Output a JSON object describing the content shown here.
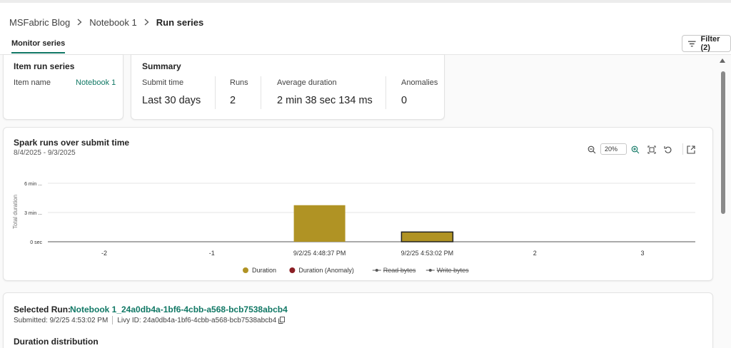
{
  "breadcrumb": [
    {
      "label": "MSFabric Blog"
    },
    {
      "label": "Notebook 1"
    },
    {
      "label": "Run series"
    }
  ],
  "tabs": [
    {
      "label": "Monitor series",
      "active": true
    }
  ],
  "filter_button": {
    "label": "Filter (2)"
  },
  "item_run_series": {
    "title": "Item run series",
    "item_name_label": "Item name",
    "item_name_value": "Notebook 1"
  },
  "summary": {
    "title": "Summary",
    "metrics": [
      {
        "label": "Submit time",
        "value": "Last 30 days"
      },
      {
        "label": "Runs",
        "value": "2"
      },
      {
        "label": "Average duration",
        "value": "2 min 38 sec 134 ms"
      },
      {
        "label": "Anomalies",
        "value": "0"
      }
    ]
  },
  "chart_card": {
    "title": "Spark runs over submit time",
    "date_range": "8/4/2025 - 9/3/2025",
    "zoom_level": "20%",
    "tools": [
      "zoom-out-icon",
      "zoom-in-icon",
      "fit-to-frame-icon",
      "reset-icon",
      "expand-icon"
    ]
  },
  "chart_data": {
    "type": "bar",
    "ylabel": "Total duration",
    "y_ticks": [
      "0 sec",
      "3 min ...",
      "6 min ..."
    ],
    "y_tick_minutes": [
      0,
      3,
      6
    ],
    "ylim_minutes": [
      0,
      6
    ],
    "x_ticks": [
      "-2",
      "-1",
      "9/2/25 4:48:37 PM",
      "9/2/25 4:53:02 PM",
      "2",
      "3"
    ],
    "series": [
      {
        "name": "Duration",
        "color": "#b09324",
        "type": "bar",
        "points": [
          {
            "x": "9/2/25 4:48:37 PM",
            "duration_minutes": 3.75,
            "selected": false
          },
          {
            "x": "9/2/25 4:53:02 PM",
            "duration_minutes": 1.0,
            "selected": true
          }
        ]
      },
      {
        "name": "Duration (Anomaly)",
        "color": "#8b1f25",
        "type": "bar",
        "points": []
      },
      {
        "name": "Read bytes",
        "color": "#555555",
        "type": "line",
        "hidden": true,
        "points": []
      },
      {
        "name": "Write bytes",
        "color": "#555555",
        "type": "line",
        "hidden": true,
        "points": []
      }
    ],
    "legend": "bottom-center",
    "grid": true
  },
  "selected_run": {
    "label": "Selected Run:",
    "name": "Notebook 1_24a0db4a-1bf6-4cbb-a568-bcb7538abcb4",
    "submitted": "Submitted: 9/2/25 4:53:02 PM",
    "livy_id": "Livy ID: 24a0db4a-1bf6-4cbb-a568-bcb7538abcb4",
    "section_title": "Duration distribution"
  },
  "colors": {
    "accent": "#117865",
    "bar": "#b09324",
    "anomaly": "#8b1f25"
  }
}
